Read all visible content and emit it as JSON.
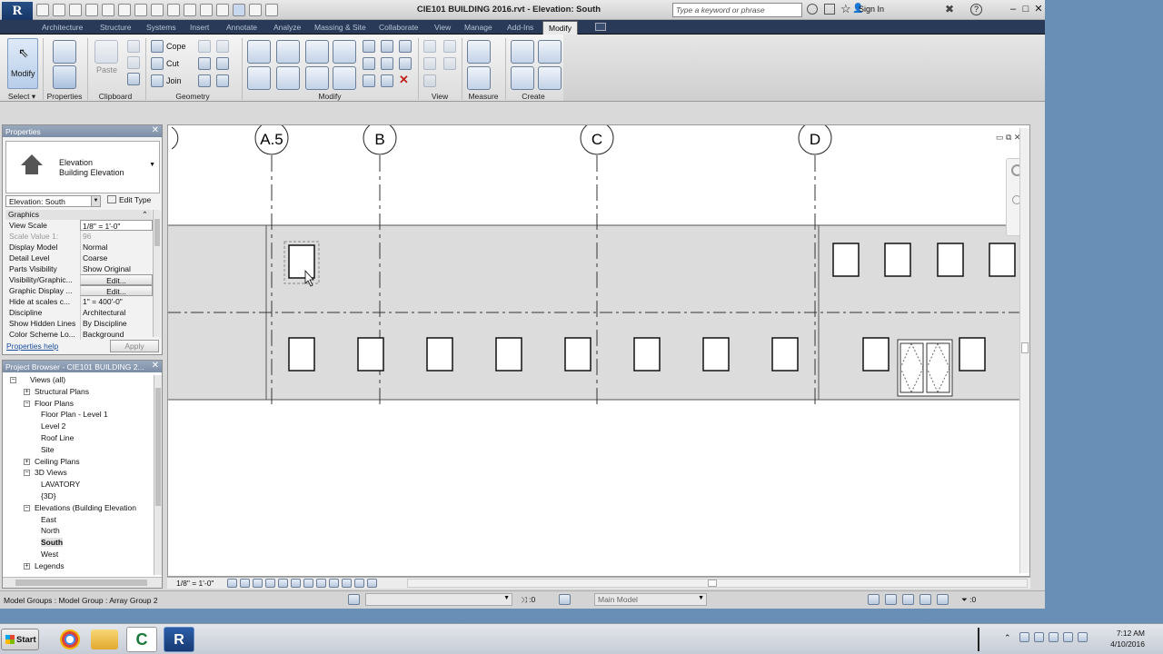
{
  "app": {
    "logo": "R",
    "title": "CIE101 BUILDING 2016.rvt - Elevation: South",
    "search_placeholder": "Type a keyword or phrase",
    "sign_in": "Sign In",
    "window_controls": [
      "–",
      "□",
      "✕"
    ]
  },
  "tabs": [
    {
      "label": "Architecture"
    },
    {
      "label": "Structure"
    },
    {
      "label": "Systems"
    },
    {
      "label": "Insert"
    },
    {
      "label": "Annotate"
    },
    {
      "label": "Analyze"
    },
    {
      "label": "Massing & Site"
    },
    {
      "label": "Collaborate"
    },
    {
      "label": "View"
    },
    {
      "label": "Manage"
    },
    {
      "label": "Add-Ins"
    },
    {
      "label": "Modify",
      "active": true
    }
  ],
  "ribbon": {
    "select_label": "Select",
    "modify_tool": "Modify",
    "panels": [
      "Properties",
      "Clipboard",
      "Geometry",
      "Modify",
      "View",
      "Measure",
      "Create"
    ],
    "properties_btn": "Properties",
    "paste_label": "Paste",
    "cope": "Cope",
    "cut": "Cut",
    "join": "Join"
  },
  "properties": {
    "header": "Properties",
    "type_line1": "Elevation",
    "type_line2": "Building Elevation",
    "instance": "Elevation: South",
    "edit_type": "Edit Type",
    "group": "Graphics",
    "rows": [
      {
        "key": "View Scale",
        "value": "1/8\" = 1'-0\""
      },
      {
        "key": "Scale Value    1:",
        "value": "96"
      },
      {
        "key": "Display Model",
        "value": "Normal"
      },
      {
        "key": "Detail Level",
        "value": "Coarse"
      },
      {
        "key": "Parts Visibility",
        "value": "Show Original"
      },
      {
        "key": "Visibility/Graphic...",
        "value": "Edit..."
      },
      {
        "key": "Graphic Display ...",
        "value": "Edit..."
      },
      {
        "key": "Hide at scales c...",
        "value": "1\" = 400'-0\""
      },
      {
        "key": "Discipline",
        "value": "Architectural"
      },
      {
        "key": "Show Hidden Lines",
        "value": "By Discipline"
      },
      {
        "key": "Color Scheme Lo...",
        "value": "Background"
      }
    ],
    "help": "Properties help",
    "apply": "Apply"
  },
  "browser": {
    "header": "Project Browser - CIE101 BUILDING 2...",
    "nodes": [
      {
        "label": "Views (all)",
        "level": 0,
        "exp": "-"
      },
      {
        "label": "Structural Plans",
        "level": 1,
        "exp": "+"
      },
      {
        "label": "Floor Plans",
        "level": 1,
        "exp": "-"
      },
      {
        "label": "Floor Plan - Level 1",
        "level": 2
      },
      {
        "label": "Level 2",
        "level": 2
      },
      {
        "label": "Roof Line",
        "level": 2
      },
      {
        "label": "Site",
        "level": 2
      },
      {
        "label": "Ceiling Plans",
        "level": 1,
        "exp": "+"
      },
      {
        "label": "3D Views",
        "level": 1,
        "exp": "-"
      },
      {
        "label": "LAVATORY",
        "level": 2
      },
      {
        "label": "{3D}",
        "level": 2
      },
      {
        "label": "Elevations (Building Elevation",
        "level": 1,
        "exp": "-"
      },
      {
        "label": "East",
        "level": 2
      },
      {
        "label": "North",
        "level": 2
      },
      {
        "label": "South",
        "level": 2,
        "bold": true
      },
      {
        "label": "West",
        "level": 2
      },
      {
        "label": "Legends",
        "level": 1,
        "exp": "+"
      }
    ]
  },
  "canvas": {
    "gridlines": [
      "A.5",
      "B",
      "C",
      "D"
    ],
    "view_scale": "1/8\" = 1'-0\""
  },
  "status": {
    "message": "Model Groups : Model Group : Array Group 2",
    "selection_count": ":0",
    "main_model": "Main Model",
    "filter_count": ":0"
  },
  "taskbar": {
    "start": "Start",
    "time": "7:12 AM",
    "date": "4/10/2016"
  },
  "colors": {
    "tabbar": "#283a58",
    "accent": "#3a6fb0",
    "desktop": "#6a8fb6"
  }
}
